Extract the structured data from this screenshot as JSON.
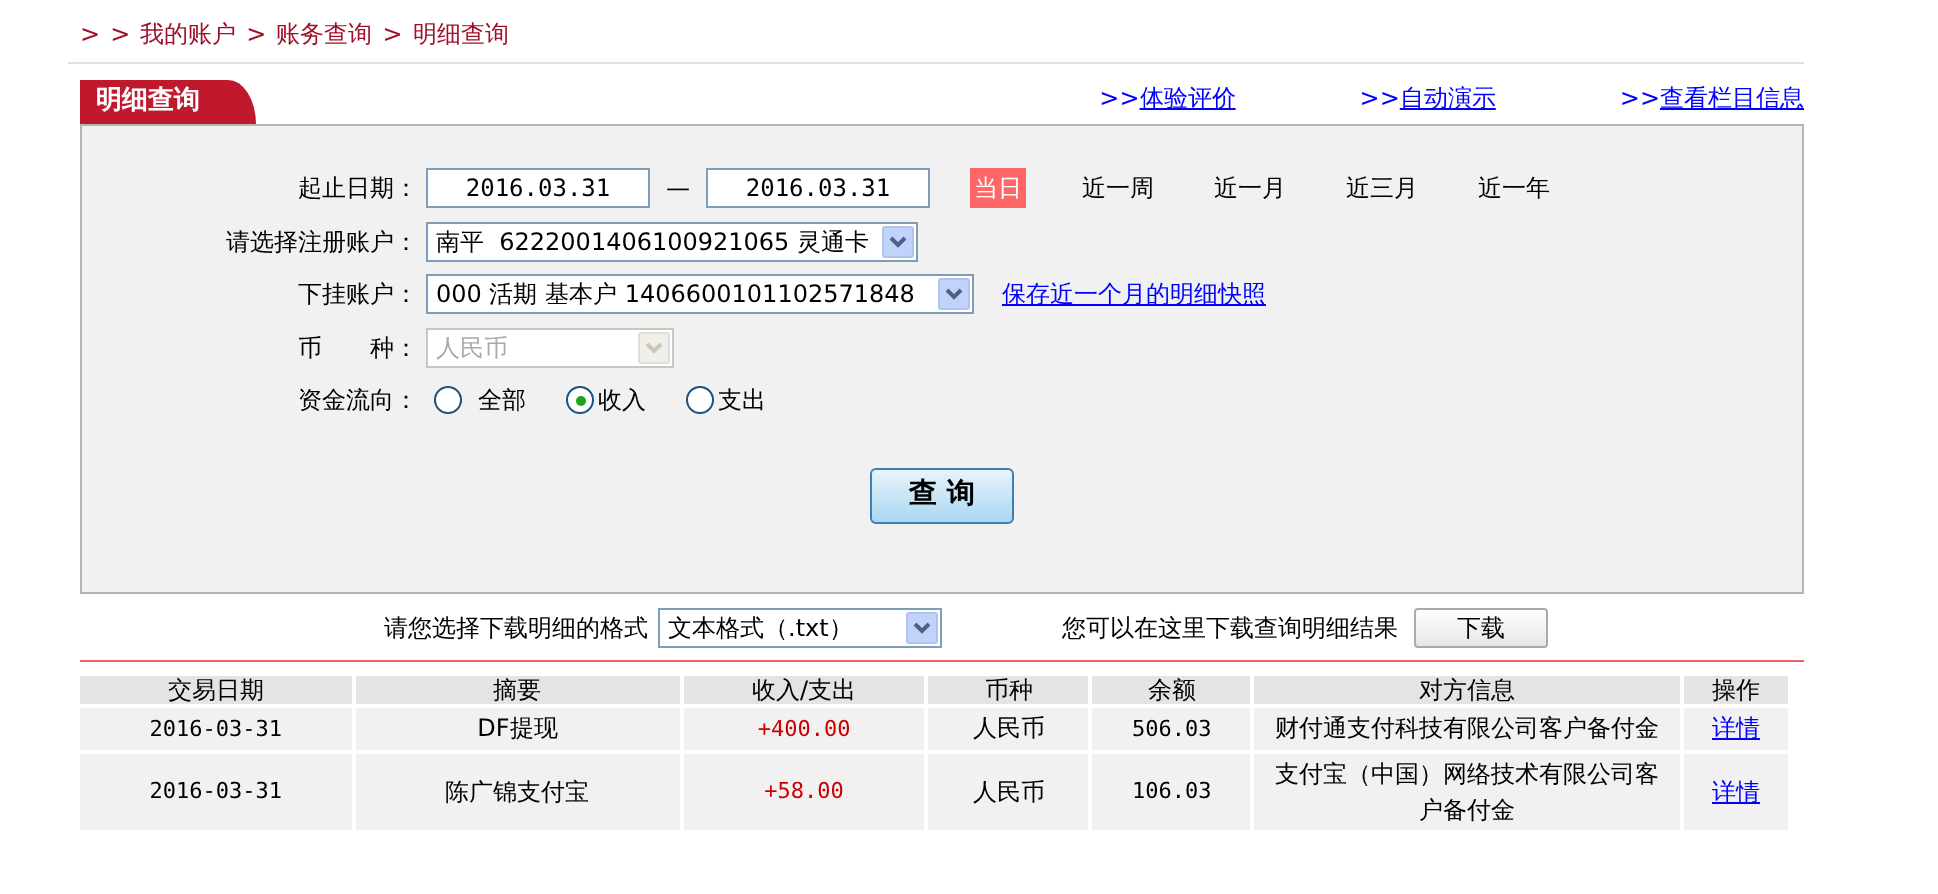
{
  "breadcrumb": [
    ">",
    ">",
    "我的账户",
    ">",
    "账务查询",
    ">",
    "明细查询"
  ],
  "panel_tab": {
    "title": "明细查询",
    "selected": true
  },
  "top_links": [
    "体验评价",
    "自动演示",
    "查看栏目信息"
  ],
  "top_link_prefix": ">>",
  "date_range": {
    "label": "起止日期：",
    "start": "2016.03.31",
    "dash": "—",
    "end": "2016.03.31"
  },
  "quick_ranges": [
    {
      "label": "当日",
      "selected": true
    },
    {
      "label": "近一周",
      "selected": false
    },
    {
      "label": "近一月",
      "selected": false
    },
    {
      "label": "近三月",
      "selected": false
    },
    {
      "label": "近一年",
      "selected": false
    }
  ],
  "register_account": {
    "label": "请选择注册账户：",
    "value": "南平  6222001406100921065 灵通卡",
    "disabled": false
  },
  "sub_account": {
    "label": "下挂账户：",
    "value": "000 活期 基本户 1406600101102571848",
    "disabled": false,
    "link": "保存近一个月的明细快照"
  },
  "currency": {
    "label": "币　　种：",
    "value": "人民币",
    "disabled": true
  },
  "fund_flow": {
    "label": "资金流向：",
    "options": [
      {
        "label": "全部",
        "selected": false
      },
      {
        "label": "收入",
        "selected": true
      },
      {
        "label": "支出",
        "selected": false
      }
    ]
  },
  "query_button": "查 询",
  "download": {
    "label": "请您选择下载明细的格式",
    "format": "文本格式（.txt）",
    "hint": "您可以在这里下载查询明细结果",
    "button": "下载"
  },
  "table": {
    "columns": [
      "交易日期",
      "摘要",
      "收入/支出",
      "币种",
      "余额",
      "对方信息",
      "操作"
    ],
    "rows": [
      {
        "date": "2016-03-31",
        "summary": "DF提现",
        "amount": "+400.00",
        "currency": "人民币",
        "balance": "506.03",
        "counterparty": "财付通支付科技有限公司客户备付金",
        "action": "详情"
      },
      {
        "date": "2016-03-31",
        "summary": "陈广锦支付宝",
        "amount": "+58.00",
        "currency": "人民币",
        "balance": "106.03",
        "counterparty": "支付宝（中国）网络技术有限公司客户备付金",
        "action": "详情"
      }
    ]
  }
}
